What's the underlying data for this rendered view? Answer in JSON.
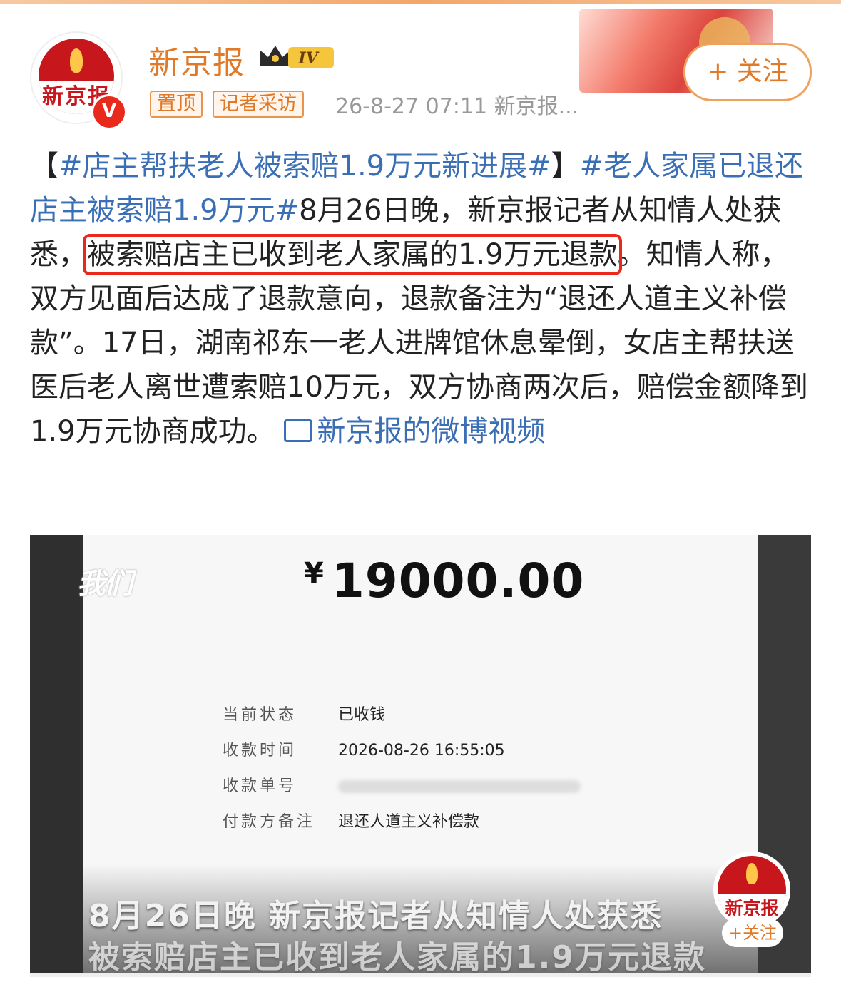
{
  "header": {
    "account_name": "新京报",
    "level_badge": "IV",
    "avatar_text": "新京报",
    "verified_mark": "V",
    "tags": [
      "置顶",
      "记者采访"
    ],
    "meta": "26-8-27 07:11  新京报...",
    "follow_label": "+ 关注"
  },
  "post": {
    "hashtag1": "#店主帮扶老人被索赔1.9万元新进展#",
    "hashtag2": "#老人家属已退还店主被索赔1.9万元#",
    "text1": "8月26日晚，新京报记者从知情人处获悉，",
    "highlight": "被索赔店主已收到老人家属的1.9万元退款",
    "text2": "。知情人称，双方见面后达成了退款意向，退款备注为“退还人道主义补偿款”。17日，湖南祁东一老人进牌馆休息晕倒，女店主帮扶送医后老人离世遭索赔10万元，双方协商两次后，赔偿金额降到1.9万元协商成功。",
    "video_link": "新京报的微博视频"
  },
  "screenshot": {
    "watermark": "我们",
    "currency": "¥",
    "amount": "19000.00",
    "rows": [
      {
        "key": "当前状态",
        "value": "已收钱"
      },
      {
        "key": "收款时间",
        "value": "2026-08-26  16:55:05"
      },
      {
        "key": "收款单号",
        "value": ""
      },
      {
        "key": "付款方备注",
        "value": "退还人道主义补偿款"
      }
    ],
    "caption1": "8月26日晚 新京报记者从知情人处获悉",
    "caption2": "被索赔店主已收到老人家属的1.9万元退款",
    "corner_logo_text": "新京报",
    "corner_follow": "+关注"
  },
  "colors": {
    "accent_orange": "#e07a28",
    "link_blue": "#3b6fb5",
    "highlight_red": "#e8291c",
    "brand_red": "#c8161d"
  }
}
